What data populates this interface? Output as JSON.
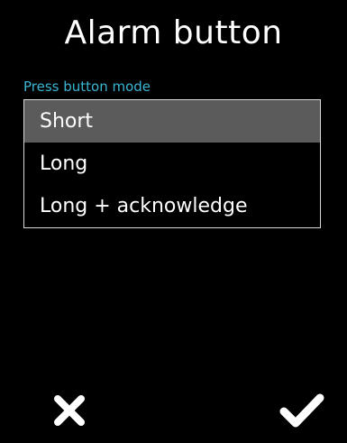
{
  "header": {
    "title": "Alarm button"
  },
  "press_mode": {
    "label": "Press button mode",
    "options": [
      {
        "label": "Short",
        "selected": true
      },
      {
        "label": "Long",
        "selected": false
      },
      {
        "label": "Long + acknowledge",
        "selected": false
      }
    ]
  },
  "footer": {
    "cancel_icon": "close-icon",
    "confirm_icon": "checkmark-icon"
  },
  "colors": {
    "background": "#000000",
    "text": "#ffffff",
    "accent": "#3ab6d4",
    "selected_row": "#5b5b5b",
    "list_border": "#d8d8d8"
  }
}
